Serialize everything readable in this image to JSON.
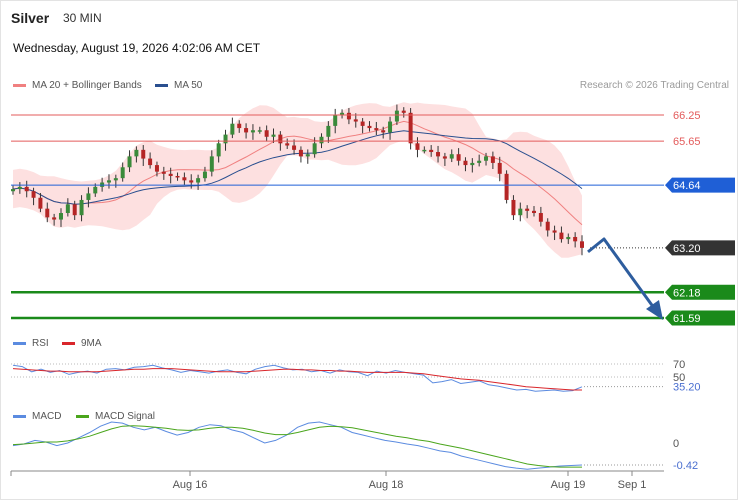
{
  "header": {
    "symbol": "Silver",
    "interval": "30 MIN",
    "datetime": "Wednesday, August 19, 2026 4:02:06 AM CET",
    "credit": "Research © 2026 Trading Central"
  },
  "legends": {
    "ma20": "MA 20 + Bollinger Bands",
    "ma50": "MA 50",
    "rsi": "RSI",
    "rsi_ma": "9MA",
    "macd": "MACD",
    "macd_signal": "MACD Signal"
  },
  "colors": {
    "ma20": "#f08080",
    "ma50": "#2a4f8f",
    "bollinger_fill": "#fde0e0",
    "resistance": "#e35b5b",
    "pivot": "#1f5fd6",
    "support": "#1a8a1a",
    "current": "#333333",
    "arrow": "#2e5d9e",
    "rsi": "#5b8be0",
    "rsi_ma": "#d9262b",
    "macd": "#5b8be0",
    "macd_signal": "#4aa51c"
  },
  "chart_data": [
    {
      "type": "candlestick",
      "title": "Silver",
      "x_tick_labels": [
        "Aug 16",
        "Aug 18",
        "Aug 19",
        "Sep 1"
      ],
      "levels": [
        {
          "value": 66.25,
          "label": "66.25",
          "kind": "resistance"
        },
        {
          "value": 65.65,
          "label": "65.65",
          "kind": "resistance"
        },
        {
          "value": 64.64,
          "label": "64.64",
          "kind": "pivot"
        },
        {
          "value": 63.2,
          "label": "63.20",
          "kind": "current"
        },
        {
          "value": 62.18,
          "label": "62.18",
          "kind": "support"
        },
        {
          "value": 61.59,
          "label": "61.59",
          "kind": "support"
        }
      ],
      "close_series": [
        64.55,
        64.6,
        64.5,
        64.35,
        64.1,
        63.9,
        63.85,
        64.0,
        64.2,
        63.95,
        64.3,
        64.45,
        64.6,
        64.7,
        64.75,
        64.8,
        65.05,
        65.3,
        65.45,
        65.25,
        65.1,
        64.95,
        64.9,
        64.85,
        64.82,
        64.75,
        64.7,
        64.8,
        64.95,
        65.3,
        65.6,
        65.8,
        66.05,
        65.95,
        65.85,
        65.9,
        65.9,
        65.75,
        65.8,
        65.6,
        65.55,
        65.45,
        65.3,
        65.35,
        65.6,
        65.75,
        66.0,
        66.25,
        66.3,
        66.15,
        66.1,
        66.0,
        65.95,
        65.9,
        65.85,
        66.1,
        66.35,
        66.3,
        65.6,
        65.45,
        65.45,
        65.4,
        65.3,
        65.25,
        65.35,
        65.2,
        65.1,
        65.15,
        65.2,
        65.3,
        65.15,
        64.9,
        64.3,
        63.95,
        64.1,
        64.05,
        64.0,
        63.8,
        63.6,
        63.55,
        63.4,
        63.45,
        63.35,
        63.2
      ]
    },
    {
      "type": "line",
      "title": "RSI",
      "y_ticks": [
        70,
        50
      ],
      "last_value": 35.2,
      "last_label": "35.20",
      "series": [
        {
          "name": "RSI",
          "values": [
            68,
            66,
            58,
            62,
            57,
            60,
            54,
            57,
            59,
            56,
            62,
            63,
            61,
            65,
            66,
            68,
            64,
            61,
            57,
            60,
            58,
            56,
            59,
            61,
            57,
            55,
            62,
            66,
            68,
            64,
            61,
            62,
            58,
            60,
            56,
            61,
            58,
            57,
            52,
            59,
            56,
            60,
            57,
            55,
            53,
            41,
            43,
            46,
            40,
            42,
            44,
            38,
            36,
            33,
            30,
            31,
            28,
            29,
            30,
            28,
            29,
            35
          ]
        },
        {
          "name": "9MA",
          "values": [
            63,
            62,
            61,
            60,
            59,
            59,
            58,
            58,
            58,
            58,
            59,
            60,
            61,
            62,
            62,
            63,
            63,
            63,
            62,
            61,
            60,
            59,
            58,
            58,
            58,
            58,
            59,
            60,
            61,
            62,
            62,
            61,
            61,
            60,
            60,
            59,
            59,
            58,
            57,
            57,
            57,
            57,
            57,
            56,
            55,
            53,
            51,
            49,
            47,
            46,
            45,
            43,
            41,
            39,
            37,
            35,
            34,
            33,
            32,
            31,
            30,
            30
          ]
        }
      ]
    },
    {
      "type": "line",
      "title": "MACD",
      "zero_label": "0",
      "last_value": -0.42,
      "last_label": "-0.42",
      "series": [
        {
          "name": "MACD",
          "values": [
            -0.05,
            -0.02,
            0.05,
            0.02,
            -0.05,
            0.0,
            0.1,
            0.2,
            0.32,
            0.4,
            0.38,
            0.3,
            0.25,
            0.3,
            0.22,
            0.15,
            0.2,
            0.3,
            0.35,
            0.33,
            0.25,
            0.2,
            0.1,
            0.0,
            0.05,
            0.15,
            0.3,
            0.38,
            0.4,
            0.35,
            0.3,
            0.2,
            0.15,
            0.1,
            0.05,
            0.02,
            -0.02,
            -0.05,
            -0.1,
            -0.15,
            -0.18,
            -0.25,
            -0.3,
            -0.35,
            -0.4,
            -0.45,
            -0.48,
            -0.5,
            -0.48,
            -0.46,
            -0.44,
            -0.43,
            -0.42
          ]
        },
        {
          "name": "MACD Signal",
          "values": [
            -0.03,
            -0.02,
            0.0,
            0.02,
            0.02,
            0.04,
            0.08,
            0.13,
            0.2,
            0.27,
            0.32,
            0.33,
            0.32,
            0.3,
            0.28,
            0.25,
            0.24,
            0.25,
            0.28,
            0.3,
            0.3,
            0.28,
            0.24,
            0.19,
            0.16,
            0.16,
            0.2,
            0.25,
            0.3,
            0.32,
            0.31,
            0.29,
            0.25,
            0.21,
            0.17,
            0.13,
            0.1,
            0.06,
            0.03,
            -0.02,
            -0.06,
            -0.1,
            -0.15,
            -0.2,
            -0.25,
            -0.3,
            -0.35,
            -0.4,
            -0.43,
            -0.45,
            -0.46,
            -0.46,
            -0.46
          ]
        }
      ]
    }
  ]
}
